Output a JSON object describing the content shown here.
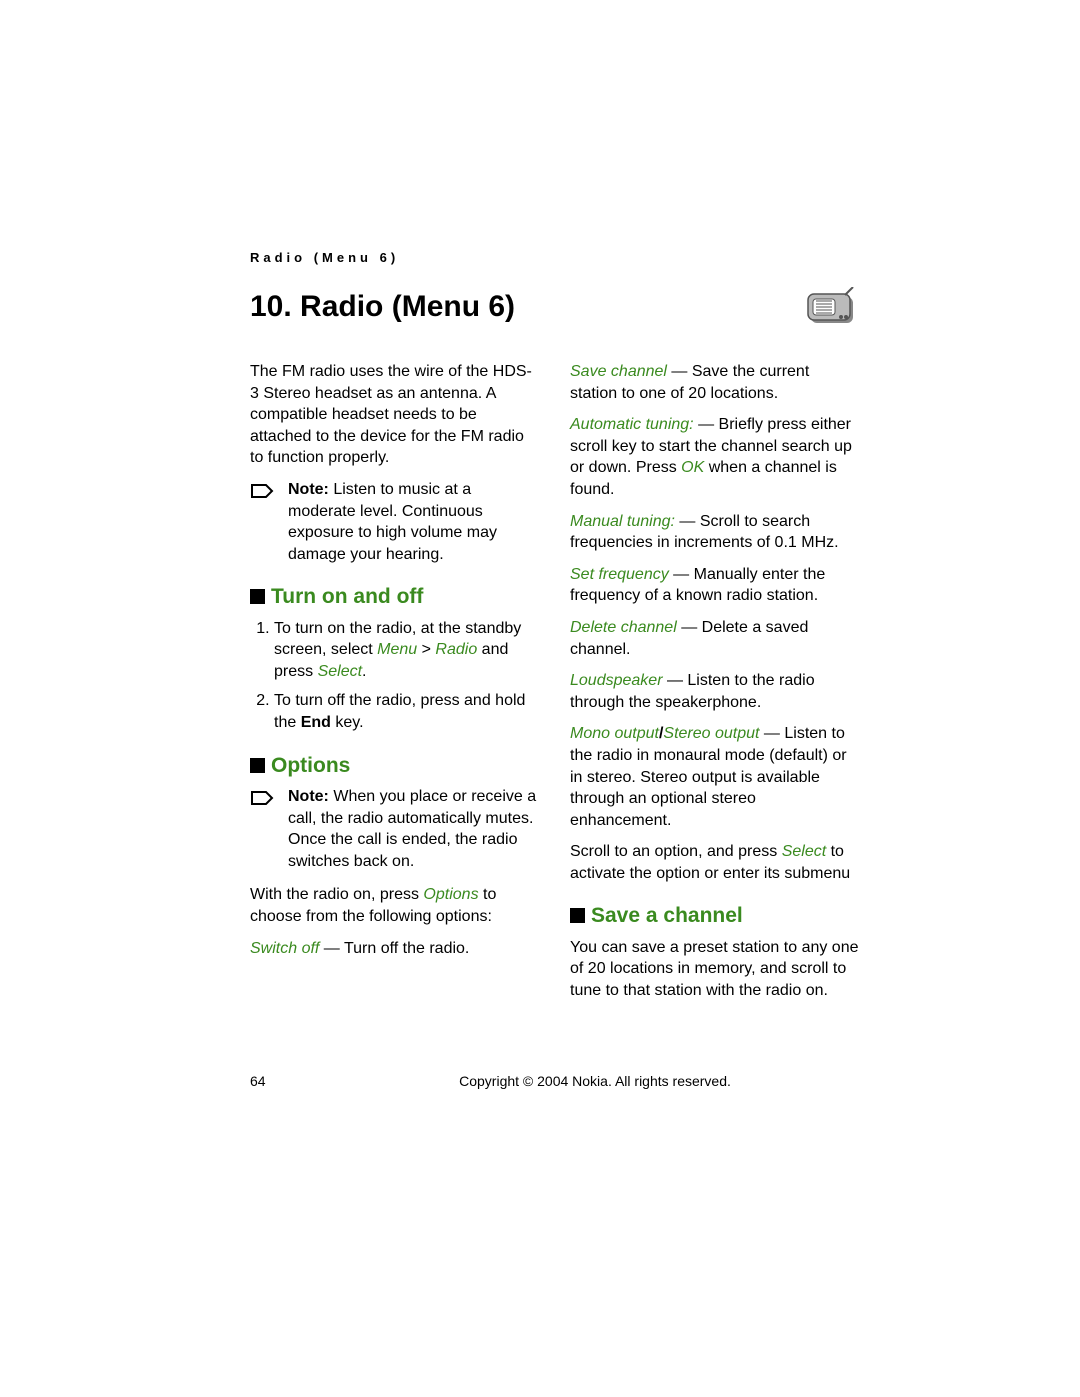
{
  "runningHeader": "Radio (Menu 6)",
  "title": "10. Radio (Menu 6)",
  "intro": "The FM radio uses the wire of the HDS-3 Stereo headset as an antenna. A compatible headset needs to be attached to the device for the FM radio to function properly.",
  "note1_label": "Note:",
  "note1_text": " Listen to music at a moderate level. Continuous exposure to high volume may damage your hearing.",
  "h_turn": "Turn on and off",
  "turn_1a": "To turn on the radio, at the standby screen, select ",
  "turn_1_menu": "Menu",
  "turn_1_gt": " > ",
  "turn_1_radio": "Radio",
  "turn_1_and": " and press ",
  "turn_1_select": "Select",
  "turn_1_dot": ".",
  "turn_2a": "To turn off the radio, press and hold the ",
  "turn_2_end": "End",
  "turn_2_key": " key.",
  "h_options": "Options",
  "note2_label": "Note:",
  "note2_text": " When you place or receive a call, the radio automatically mutes. Once the call is ended, the radio switches back on.",
  "opt_intro_a": "With the radio on, press ",
  "opt_intro_options": "Options",
  "opt_intro_b": " to choose from the following options:",
  "switchoff_label": "Switch off",
  "switchoff_text": " — Turn off the radio.",
  "savechannel_label": "Save channel",
  "savechannel_text": " — Save the current station to one of 20 locations.",
  "auto_label": "Automatic tuning:",
  "auto_text_a": " — Briefly press either scroll key to start the channel search up or down. Press ",
  "auto_ok": "OK",
  "auto_text_b": " when a channel is found.",
  "manual_label": "Manual tuning:",
  "manual_text": " — Scroll to search frequencies in increments of 0.1 MHz.",
  "setfreq_label": "Set frequency",
  "setfreq_text": " — Manually enter the frequency of a known radio station.",
  "delete_label": "Delete channel",
  "delete_text": " — Delete a saved channel.",
  "loud_label": "Loudspeaker",
  "loud_text": " — Listen to the radio through the speakerphone.",
  "mono_label_a": "Mono output",
  "mono_slash": "/",
  "mono_label_b": "Stereo output",
  "mono_dash": " — ",
  "mono_text": "Listen to the radio in monaural mode (default) or in stereo. Stereo output is available through an optional stereo enhancement.",
  "scroll_a": "Scroll to an option, and press ",
  "scroll_select": "Select",
  "scroll_b": " to activate the option or enter its submenu",
  "h_save": "Save a channel",
  "save_text": "You can save a preset station to any one of 20 locations in memory, and scroll to tune to that station with the radio on.",
  "pageNum": "64",
  "copyright": "Copyright © 2004 Nokia. All rights reserved."
}
